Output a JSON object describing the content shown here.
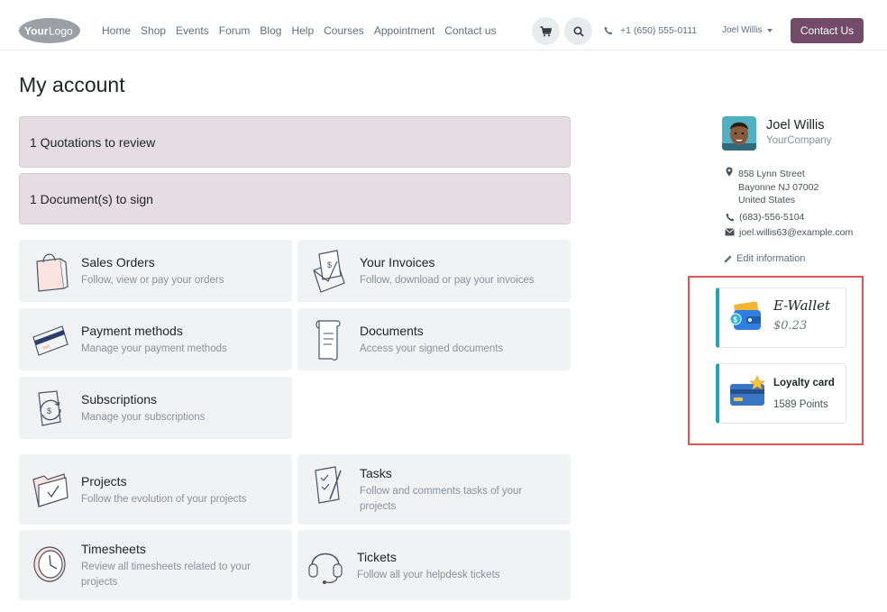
{
  "navbar": {
    "logo_text": "YourLogo",
    "links": [
      "Home",
      "Shop",
      "Events",
      "Forum",
      "Blog",
      "Help",
      "Courses",
      "Appointment",
      "Contact us"
    ],
    "cart_icon": "cart-icon",
    "search_icon": "search-icon",
    "phone": "+1 (650) 555-0111",
    "user_name": "Joel Willis",
    "contact_button": "Contact Us"
  },
  "page": {
    "title": "My account"
  },
  "alerts": {
    "quotations": "1 Quotations to review",
    "documents": "1 Document(s) to sign"
  },
  "cards": [
    {
      "title": "Sales Orders",
      "desc": "Follow, view or pay your orders",
      "icon": "shopping-bag-icon"
    },
    {
      "title": "Your Invoices",
      "desc": "Follow, download or pay your invoices",
      "icon": "invoice-icon"
    },
    {
      "title": "Payment methods",
      "desc": "Manage your payment methods",
      "icon": "credit-card-icon"
    },
    {
      "title": "Documents",
      "desc": "Access your signed documents",
      "icon": "document-scroll-icon"
    },
    {
      "title": "Subscriptions",
      "desc": "Manage your subscriptions",
      "icon": "subscription-icon"
    },
    {
      "title": "Projects",
      "desc": "Follow the evolution of your projects",
      "icon": "folder-check-icon"
    },
    {
      "title": "Tasks",
      "desc": "Follow and comments tasks of your projects",
      "icon": "task-clipboard-icon"
    },
    {
      "title": "Timesheets",
      "desc": "Review all timesheets related to your projects",
      "icon": "clock-icon"
    },
    {
      "title": "Tickets",
      "desc": "Follow all your helpdesk tickets",
      "icon": "headset-icon"
    }
  ],
  "profile": {
    "name": "Joel Willis",
    "company": "YourCompany",
    "address": [
      "858 Lynn Street",
      "Bayonne NJ 07002",
      "United States"
    ],
    "phone": "(683)-556-5104",
    "email": "joel.willis63@example.com",
    "edit_label": "Edit information"
  },
  "wallet": {
    "title": "E-Wallet",
    "value": "$0.23"
  },
  "loyalty": {
    "title": "Loyalty card",
    "value": "1589 Points"
  },
  "colors": {
    "brand": "#714b67",
    "alert_bg": "#e6dde3",
    "card_bg": "#f1f2f3",
    "accent_border": "#1fa5b3",
    "highlight": "#e05555"
  }
}
